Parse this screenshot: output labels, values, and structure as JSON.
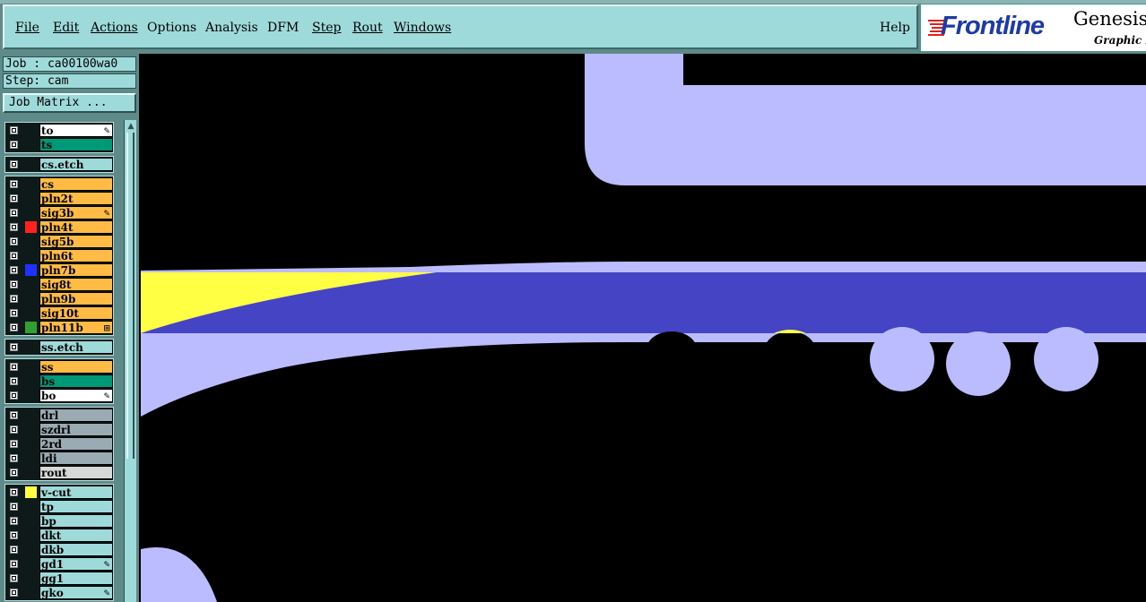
{
  "menu": {
    "items": [
      "File",
      "Edit",
      "Actions",
      "Options",
      "Analysis",
      "DFM",
      "Step",
      "Rout",
      "Windows"
    ],
    "help": "Help"
  },
  "brand": {
    "logo": "Frontline",
    "product": "Genesis",
    "tagline": "Graphic E"
  },
  "job": {
    "job_label": "Job : ca00100wa0",
    "step_label": "Step: cam",
    "matrix_button": "Job Matrix ..."
  },
  "colors": {
    "panel_cyan": "#9edada",
    "layer_green": "#009977",
    "layer_orange": "#ffbb44",
    "layer_gray": "#9aabb4",
    "canvas_light": "#bbbbff",
    "canvas_dark": "#4444c4",
    "canvas_yellow": "#ffff44"
  },
  "layers": [
    {
      "name": "to",
      "bg": "#ffffff",
      "flag": "edit-icon",
      "swatch": ""
    },
    {
      "name": "ts",
      "bg": "#009977",
      "flag": "",
      "swatch": ""
    },
    {
      "name": "cs.etch",
      "bg": "#9edada",
      "flag": "",
      "swatch": ""
    },
    {
      "name": "cs",
      "bg": "#ffbb44",
      "flag": "",
      "swatch": ""
    },
    {
      "name": "pln2t",
      "bg": "#ffbb44",
      "flag": "",
      "swatch": ""
    },
    {
      "name": "sig3b",
      "bg": "#ffbb44",
      "flag": "edit-icon",
      "swatch": ""
    },
    {
      "name": "pln4t",
      "bg": "#ffbb44",
      "flag": "",
      "swatch": "#ff2020"
    },
    {
      "name": "sig5b",
      "bg": "#ffbb44",
      "flag": "",
      "swatch": ""
    },
    {
      "name": "pln6t",
      "bg": "#ffbb44",
      "flag": "",
      "swatch": ""
    },
    {
      "name": "pln7b",
      "bg": "#ffbb44",
      "flag": "",
      "swatch": "#2030ff"
    },
    {
      "name": "sig8t",
      "bg": "#ffbb44",
      "flag": "",
      "swatch": ""
    },
    {
      "name": "pln9b",
      "bg": "#ffbb44",
      "flag": "",
      "swatch": ""
    },
    {
      "name": "sig10t",
      "bg": "#ffbb44",
      "flag": "",
      "swatch": ""
    },
    {
      "name": "pln11b",
      "bg": "#ffbb44",
      "flag": "grid-icon",
      "swatch": "#30a030"
    },
    {
      "name": "ss.etch",
      "bg": "#9edada",
      "flag": "",
      "swatch": ""
    },
    {
      "name": "ss",
      "bg": "#ffbb44",
      "flag": "",
      "swatch": ""
    },
    {
      "name": "bs",
      "bg": "#009977",
      "flag": "",
      "swatch": ""
    },
    {
      "name": "bo",
      "bg": "#ffffff",
      "flag": "edit-icon",
      "swatch": ""
    },
    {
      "name": "drl",
      "bg": "#9aabb4",
      "flag": "",
      "swatch": ""
    },
    {
      "name": "szdrl",
      "bg": "#9aabb4",
      "flag": "",
      "swatch": ""
    },
    {
      "name": "2rd",
      "bg": "#9aabb4",
      "flag": "",
      "swatch": ""
    },
    {
      "name": "ldi",
      "bg": "#9aabb4",
      "flag": "",
      "swatch": ""
    },
    {
      "name": "rout",
      "bg": "#d8d8d8",
      "flag": "",
      "swatch": ""
    },
    {
      "name": "v-cut",
      "bg": "#9edada",
      "flag": "",
      "swatch": "#ffff44"
    },
    {
      "name": "tp",
      "bg": "#9edada",
      "flag": "",
      "swatch": ""
    },
    {
      "name": "bp",
      "bg": "#9edada",
      "flag": "",
      "swatch": ""
    },
    {
      "name": "dkt",
      "bg": "#9edada",
      "flag": "",
      "swatch": ""
    },
    {
      "name": "dkb",
      "bg": "#9edada",
      "flag": "",
      "swatch": ""
    },
    {
      "name": "gd1",
      "bg": "#9edada",
      "flag": "edit-icon",
      "swatch": ""
    },
    {
      "name": "gg1",
      "bg": "#9edada",
      "flag": "",
      "swatch": ""
    },
    {
      "name": "gko",
      "bg": "#9edada",
      "flag": "edit-icon",
      "swatch": ""
    }
  ]
}
